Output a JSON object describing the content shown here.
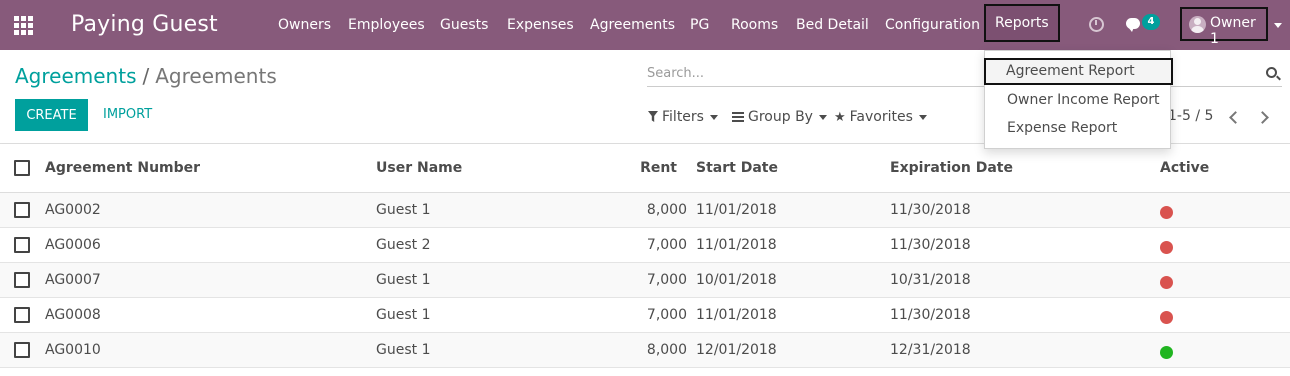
{
  "navbar": {
    "app_title": "Paying Guest",
    "menu": [
      {
        "label": "Owners"
      },
      {
        "label": "Employees"
      },
      {
        "label": "Guests"
      },
      {
        "label": "Expenses"
      },
      {
        "label": "Agreements"
      },
      {
        "label": "PG"
      },
      {
        "label": "Rooms"
      },
      {
        "label": "Bed Detail"
      },
      {
        "label": "Configuration"
      },
      {
        "label": "Reports"
      }
    ],
    "messages_count": "4",
    "user_name": "Owner 1",
    "color": "#875a7b"
  },
  "breadcrumb": {
    "parent": "Agreements",
    "separator": "/",
    "current": "Agreements"
  },
  "actions": {
    "create": "CREATE",
    "import": "IMPORT",
    "accent": "#00a09d"
  },
  "search": {
    "placeholder": "Search..."
  },
  "filters": {
    "filters_label": "Filters",
    "group_by_label": "Group By",
    "favorites_label": "Favorites"
  },
  "pager": {
    "text": "1-5 / 5"
  },
  "reports_menu": {
    "items": [
      {
        "label": "Agreement Report"
      },
      {
        "label": "Owner Income Report"
      },
      {
        "label": "Expense Report"
      }
    ]
  },
  "table": {
    "columns": {
      "number": "Agreement Number",
      "user": "User Name",
      "rent": "Rent",
      "start": "Start Date",
      "expiration": "Expiration Date",
      "active": "Active"
    },
    "rows": [
      {
        "number": "AG0002",
        "user": "Guest 1",
        "rent": "8,000",
        "start": "11/01/2018",
        "expiration": "11/30/2018",
        "active": "red"
      },
      {
        "number": "AG0006",
        "user": "Guest 2",
        "rent": "7,000",
        "start": "11/01/2018",
        "expiration": "11/30/2018",
        "active": "red"
      },
      {
        "number": "AG0007",
        "user": "Guest 1",
        "rent": "7,000",
        "start": "10/01/2018",
        "expiration": "10/31/2018",
        "active": "red"
      },
      {
        "number": "AG0008",
        "user": "Guest 1",
        "rent": "7,000",
        "start": "11/01/2018",
        "expiration": "11/30/2018",
        "active": "red"
      },
      {
        "number": "AG0010",
        "user": "Guest 1",
        "rent": "8,000",
        "start": "12/01/2018",
        "expiration": "12/31/2018",
        "active": "green"
      }
    ],
    "status_colors": {
      "red": "#d9534f",
      "green": "#21b521"
    }
  }
}
